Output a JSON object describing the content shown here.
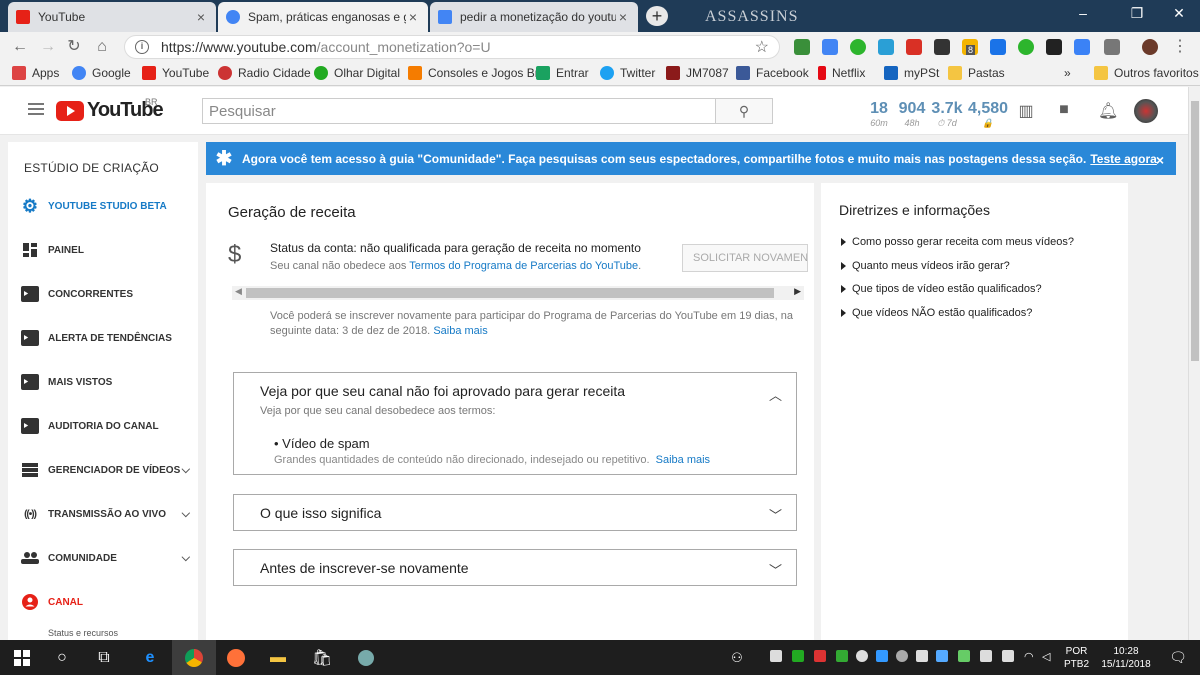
{
  "browser": {
    "tabs": [
      {
        "title": "YouTube",
        "active": false,
        "color": "#e62117"
      },
      {
        "title": "Spam, práticas enganosas e golp",
        "active": true,
        "color": "#4285f4"
      },
      {
        "title": "pedir a monetização do youtube",
        "active": false,
        "color": "#4285f4"
      }
    ],
    "new_tab": "+",
    "brand_watermark": "ASSASSINS",
    "url_main": "https://www.youtube.com",
    "url_path": "/account_monetization?o=U",
    "bookmarks": [
      {
        "label": "Apps",
        "color": "#d44"
      },
      {
        "label": "Google",
        "color": "#4285f4"
      },
      {
        "label": "YouTube",
        "color": "#e62117"
      },
      {
        "label": "Radio Cidade",
        "color": "#c33"
      },
      {
        "label": "Olhar Digital",
        "color": "#2a2"
      },
      {
        "label": "Consoles e Jogos Br",
        "color": "#f57c00"
      },
      {
        "label": "Entrar",
        "color": "#1aa260"
      },
      {
        "label": "Twitter",
        "color": "#1da1f2"
      },
      {
        "label": "JM7087",
        "color": "#8b1a1a"
      },
      {
        "label": "Facebook",
        "color": "#3b5998"
      },
      {
        "label": "Netflix",
        "color": "#e50914"
      },
      {
        "label": "myPSt",
        "color": "#1565c0"
      },
      {
        "label": "Pastas",
        "color": "#f4c542"
      }
    ],
    "bookmarks_more": "»",
    "other_bookmarks": "Outros favoritos",
    "extension_badge": "8"
  },
  "youtube": {
    "logo_text": "YouTube",
    "country": "BR",
    "search_placeholder": "Pesquisar",
    "stats": [
      {
        "value": "18",
        "label": "60m"
      },
      {
        "value": "904",
        "label": "48h"
      },
      {
        "value": "3.7k",
        "label": "⏱ 7d"
      },
      {
        "value": "4,580",
        "label": "🔒"
      }
    ]
  },
  "sidebar": {
    "title": "ESTÚDIO DE CRIAÇÃO",
    "items": [
      {
        "label": "YOUTUBE STUDIO BETA",
        "color": "#167ac6"
      },
      {
        "label": "PAINEL",
        "color": "#333"
      },
      {
        "label": "CONCORRENTES",
        "color": "#333"
      },
      {
        "label": "ALERTA DE TENDÊNCIAS",
        "color": "#333"
      },
      {
        "label": "MAIS VISTOS",
        "color": "#333"
      },
      {
        "label": "AUDITORIA DO CANAL",
        "color": "#333"
      },
      {
        "label": "GERENCIADOR DE VÍDEOS",
        "color": "#333"
      },
      {
        "label": "TRANSMISSÃO AO VIVO",
        "color": "#333"
      },
      {
        "label": "COMUNIDADE",
        "color": "#333"
      },
      {
        "label": "CANAL",
        "color": "#e62117"
      }
    ],
    "sub_item": "Status e recursos"
  },
  "banner": {
    "text": "Agora você tem acesso à guia \"Comunidade\". Faça pesquisas com seus espectadores, compartilhe fotos e muito mais nas postagens dessa seção.",
    "link": "Teste agora",
    "close": "×"
  },
  "main": {
    "title": "Geração de receita",
    "status_title": "Status da conta: não qualificada para geração de receita no momento",
    "status_prefix": "Seu canal não obedece aos ",
    "status_link": "Termos do Programa de Parcerias do YouTube",
    "status_suffix": ".",
    "request_button": "SOLICITAR NOVAMENTE",
    "reenroll_text": "Você poderá se inscrever novamente para participar do Programa de Parcerias do YouTube em 19 dias, na seguinte data: 3 de dez de 2018.",
    "reenroll_link": "Saiba mais",
    "accordion1": {
      "title": "Veja por que seu canal não foi aprovado para gerar receita",
      "subtitle": "Veja por que seu canal desobedece aos termos:",
      "bullet": "Vídeo de spam",
      "bullet_desc": "Grandes quantidades de conteúdo não direcionado, indesejado ou repetitivo.",
      "bullet_link": "Saiba mais"
    },
    "accordion2": {
      "title": "O que isso significa"
    },
    "accordion3": {
      "title": "Antes de inscrever-se novamente"
    }
  },
  "right": {
    "title": "Diretrizes e informações",
    "items": [
      "Como posso gerar receita com meus vídeos?",
      "Quanto meus vídeos irão gerar?",
      "Que tipos de vídeo estão qualificados?",
      "Que vídeos NÃO estão qualificados?"
    ]
  },
  "taskbar": {
    "lang1": "POR",
    "lang2": "PTB2",
    "time": "10:28",
    "date": "15/11/2018"
  }
}
